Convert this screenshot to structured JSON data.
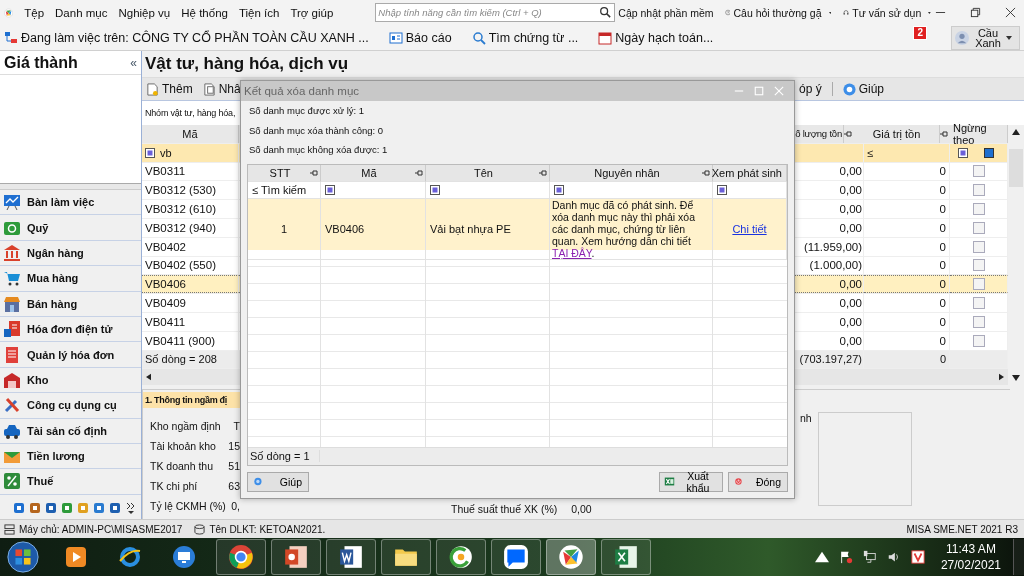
{
  "menu": {
    "items": [
      "Tệp",
      "Danh mục",
      "Nghiệp vụ",
      "Hệ thống",
      "Tiện ích",
      "Trợ giúp"
    ],
    "search": {
      "placeholder": "Nhập tính năng cần tìm kiếm (Ctrl + Q)"
    },
    "update": "Cập nhật phần mềm",
    "faq": "Câu hỏi thường gặ",
    "support": "Tư vấn sử dụn"
  },
  "workbar": {
    "company": "Đang làm việc trên: CÔNG TY CỔ PHẦN TOÀN CẦU XANH ...",
    "buttons": [
      "Báo cáo",
      "Tìm chứng từ ...",
      "Ngày hạch toán..."
    ],
    "notifications": "2",
    "user": "Cầu Xanh"
  },
  "sidebar": {
    "title": "Giá thành",
    "collapse": "«",
    "modules": [
      {
        "label": "Bàn làm việc"
      },
      {
        "label": "Quỹ"
      },
      {
        "label": "Ngân hàng"
      },
      {
        "label": "Mua hàng"
      },
      {
        "label": "Bán hàng"
      },
      {
        "label": "Hóa đơn điện tử"
      },
      {
        "label": "Quản lý hóa đơn"
      },
      {
        "label": "Kho"
      },
      {
        "label": "Công cụ dụng cụ"
      },
      {
        "label": "Tài sản cố định"
      },
      {
        "label": "Tiền lương"
      },
      {
        "label": "Thuế"
      }
    ]
  },
  "page": {
    "title": "Vật tư, hàng hóa, dịch vụ",
    "toolbar": [
      "Thêm",
      "Nhâ"
    ],
    "toolbar_right": [
      "óp ý",
      "Giúp"
    ],
    "group_filter": "Nhóm vật tư, hàng hóa,",
    "grid": {
      "columns": [
        "Mã",
        "ố lượng tồn",
        "Giá trị tồn",
        "Ngừng theo"
      ],
      "filter": {
        "code": "vb",
        "op": "≤"
      },
      "rows": [
        {
          "code": "VB0311",
          "qty": "0,00",
          "value": "0",
          "stopped": false,
          "selected": false
        },
        {
          "code": "VB0312 (530)",
          "qty": "0,00",
          "value": "0",
          "stopped": false,
          "selected": false
        },
        {
          "code": "VB0312 (610)",
          "qty": "0,00",
          "value": "0",
          "stopped": false,
          "selected": false
        },
        {
          "code": "VB0312 (940)",
          "qty": "0,00",
          "value": "0",
          "stopped": false,
          "selected": false
        },
        {
          "code": "VB0402",
          "qty": "(11.959,00)",
          "value": "0",
          "stopped": false,
          "selected": false
        },
        {
          "code": "VB0402 (550)",
          "qty": "(1.000,00)",
          "value": "0",
          "stopped": false,
          "selected": false
        },
        {
          "code": "VB0406",
          "qty": "0,00",
          "value": "0",
          "stopped": false,
          "selected": true
        },
        {
          "code": "VB0409",
          "qty": "0,00",
          "value": "0",
          "stopped": false,
          "selected": false
        },
        {
          "code": "VB0411",
          "qty": "0,00",
          "value": "0",
          "stopped": false,
          "selected": false
        },
        {
          "code": "VB0411 (900)",
          "qty": "0,00",
          "value": "0",
          "stopped": false,
          "selected": false
        }
      ],
      "footer": {
        "count": "Số dòng = 208",
        "qty": "(703.197,27)",
        "value": "0"
      }
    },
    "detail": {
      "tab": "1. Thông tin ngầm đị",
      "fields": [
        {
          "label": "Kho ngầm định",
          "value": "T"
        },
        {
          "label": "Tài khoản kho",
          "value": "15"
        },
        {
          "label": "TK doanh thu",
          "value": "51"
        },
        {
          "label": "TK chi phí",
          "value": "63"
        },
        {
          "label": "Tỷ lệ CKMH (%)",
          "value": "0,"
        }
      ],
      "export_tax": {
        "label": "Thuế suất thuế XK (%)",
        "value": "0,00"
      },
      "right_label": "nh"
    }
  },
  "dialog": {
    "title": "Kết quả xóa danh mục",
    "stats": [
      "Số danh mục được xử lý: 1",
      "Số danh mục xóa thành công: 0",
      "Số danh mục không xóa được: 1"
    ],
    "columns": [
      "STT",
      "Mã",
      "Tên",
      "Nguyên nhân",
      "Xem phát sinh"
    ],
    "search_label": "≤ Tìm kiếm",
    "rows": [
      {
        "stt": "1",
        "code": "VB0406",
        "name": "Vải bạt nhựa PE",
        "reason": "Danh mục đã có phát sinh. Để xóa danh mục này thì phải xóa các danh mục, chứng từ liên quan. Xem hướng dẫn chi tiết",
        "reason_link": "TẠI ĐÂY",
        "reason_end": ".",
        "detail_link": "Chi tiết"
      }
    ],
    "count": "Số dòng = 1",
    "buttons": [
      {
        "label": "Giúp",
        "kind": "help"
      },
      {
        "label": "Xuất khẩu",
        "kind": "export"
      },
      {
        "label": "Đóng",
        "kind": "close"
      }
    ]
  },
  "status": {
    "server": "Máy chủ: ADMIN-PC\\MISASME2017",
    "db": "Tên DLKT: KETOAN2021.",
    "version": "MISA SME.NET 2021 R3"
  },
  "taskbar": {
    "time": "11:43 AM",
    "date": "27/02/2021"
  }
}
